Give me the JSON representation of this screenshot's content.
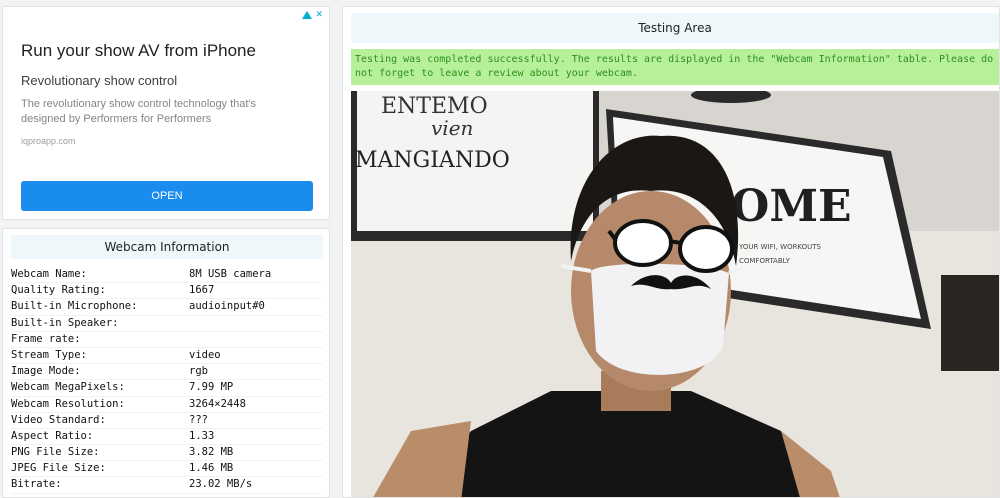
{
  "ad": {
    "title": "Run your show AV from iPhone",
    "subtitle": "Revolutionary show control",
    "description": "The revolutionary show control technology that's designed by Performers for Performers",
    "url": "iqproapp.com",
    "button_label": "OPEN",
    "icon": "adchoices-icon"
  },
  "webcam_info": {
    "title": "Webcam Information",
    "rows": [
      {
        "label": "Webcam Name:",
        "value": "8M USB camera"
      },
      {
        "label": "Quality Rating:",
        "value": "1667"
      },
      {
        "label": "Built-in Microphone:",
        "value": "audioinput#0"
      },
      {
        "label": "Built-in Speaker:",
        "value": ""
      },
      {
        "label": "Frame rate:",
        "value": ""
      },
      {
        "label": "Stream Type:",
        "value": "video"
      },
      {
        "label": "Image Mode:",
        "value": "rgb"
      },
      {
        "label": "Webcam MegaPixels:",
        "value": "7.99 MP"
      },
      {
        "label": "Webcam Resolution:",
        "value": "3264×2448"
      },
      {
        "label": "Video Standard:",
        "value": "???"
      },
      {
        "label": "Aspect Ratio:",
        "value": "1.33"
      },
      {
        "label": "PNG File Size:",
        "value": "3.82 MB"
      },
      {
        "label": "JPEG File Size:",
        "value": "1.46 MB"
      },
      {
        "label": "Bitrate:",
        "value": "23.02 MB/s"
      }
    ]
  },
  "testing": {
    "title": "Testing Area",
    "message": "Testing was completed successfully. The results are displayed in the \"Webcam Information\" table. Please do not forget to leave a review about your webcam.",
    "frame_text": {
      "poster_line1": "ENTEMO",
      "poster_line2": "vien",
      "poster_line3": "MANGIANDO",
      "home_sign": "OME",
      "home_small1": "YOUR WIFI, WORKOUTS",
      "home_small2": "COMFORTABLY"
    }
  },
  "colors": {
    "accent": "#1a8cf0",
    "success_bg": "#b7f09a",
    "success_text": "#2f8f1e",
    "header_bg": "#eef8fb"
  }
}
